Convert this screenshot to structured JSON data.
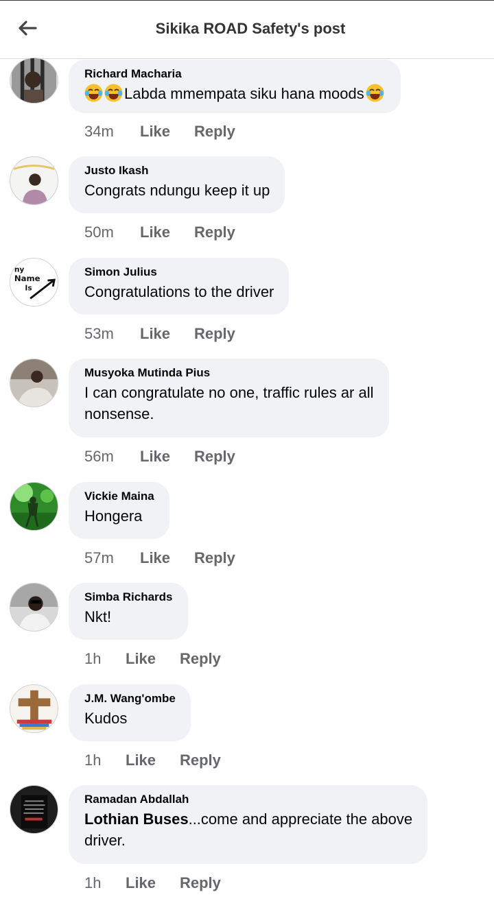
{
  "header": {
    "title": "Sikika ROAD Safety's post",
    "back_icon": "back-arrow-icon"
  },
  "comments": [
    {
      "author": "Richard Macharia",
      "text_parts": [
        "Labda mmempata siku hana moods"
      ],
      "emoji": "face-with-tears-of-joy",
      "time": "34m",
      "like": "Like",
      "reply": "Reply"
    },
    {
      "author": "Justo Ikash",
      "text": "Congrats ndungu keep it up",
      "time": "50m",
      "like": "Like",
      "reply": "Reply"
    },
    {
      "author": "Simon Julius",
      "text": "Congratulations to the driver",
      "time": "53m",
      "like": "Like",
      "reply": "Reply",
      "avatar_text": [
        "ny",
        "Name",
        "Is"
      ]
    },
    {
      "author": "Musyoka Mutinda Pius",
      "text": "I can congratulate no one, traffic rules ar all",
      "text2": "nonsense.",
      "time": "56m",
      "like": "Like",
      "reply": "Reply"
    },
    {
      "author": "Vickie Maina",
      "text": "Hongera",
      "time": "57m",
      "like": "Like",
      "reply": "Reply"
    },
    {
      "author": "Simba Richards",
      "text": "Nkt!",
      "time": "1h",
      "like": "Like",
      "reply": "Reply"
    },
    {
      "author": "J.M. Wang'ombe",
      "text": "Kudos",
      "time": "1h",
      "like": "Like",
      "reply": "Reply"
    },
    {
      "author": "Ramadan Abdallah",
      "mention": "Lothian Buses",
      "text": "...come and  appreciate the above",
      "text2": "driver.",
      "time": "1h",
      "like": "Like",
      "reply": "Reply"
    }
  ],
  "colors": {
    "bubble": "#f0f2f5",
    "meta": "#65676b",
    "text": "#050505"
  }
}
